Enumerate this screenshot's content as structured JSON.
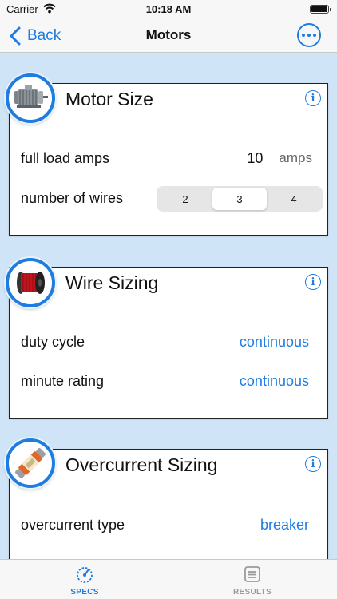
{
  "status": {
    "carrier": "Carrier",
    "time": "10:18 AM"
  },
  "nav": {
    "back_label": "Back",
    "title": "Motors"
  },
  "cards": {
    "motor": {
      "title": "Motor Size",
      "full_load_amps_label": "full load amps",
      "full_load_amps_value": "10",
      "full_load_amps_unit": "amps",
      "wires_label": "number of wires",
      "wire_options": [
        "2",
        "3",
        "4"
      ],
      "wire_selected": "3"
    },
    "wire": {
      "title": "Wire Sizing",
      "duty_label": "duty cycle",
      "duty_value": "continuous",
      "minute_label": "minute rating",
      "minute_value": "continuous"
    },
    "overcurrent": {
      "title": "Overcurrent Sizing",
      "type_label": "overcurrent type",
      "type_value": "breaker"
    }
  },
  "tabs": [
    {
      "label": "SPECS",
      "icon": "gauge-icon",
      "selected": true
    },
    {
      "label": "RESULTS",
      "icon": "list-icon",
      "selected": false
    }
  ],
  "colors": {
    "accent": "#1f7ce0",
    "background": "#cfe4f6",
    "tab_inactive": "#9a9a9a"
  }
}
